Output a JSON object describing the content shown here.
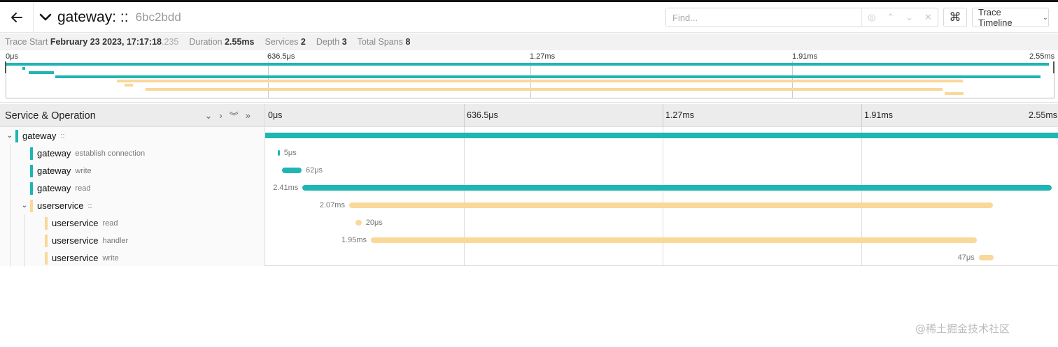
{
  "header": {
    "back_icon": "arrow-left-icon",
    "collapse_icon": "chevron-down-icon",
    "title": "gateway: ::",
    "trace_id": "6bc2bdd",
    "find_placeholder": "Find...",
    "keyboard_icon": "command-icon",
    "keyboard_glyph": "⌘",
    "view_select_value": "Trace Timeline"
  },
  "meta": {
    "trace_start_label": "Trace Start",
    "trace_start_value": "February 23 2023, 17:17:18",
    "trace_start_ms": ".235",
    "duration_label": "Duration",
    "duration_value": "2.55ms",
    "services_label": "Services",
    "services_value": "2",
    "depth_label": "Depth",
    "depth_value": "3",
    "total_spans_label": "Total Spans",
    "total_spans_value": "8"
  },
  "ticks": [
    "0μs",
    "636.5μs",
    "1.27ms",
    "1.91ms",
    "2.55ms"
  ],
  "table": {
    "service_operation_label": "Service & Operation"
  },
  "colors": {
    "gateway": "#1fb5b3",
    "userservice": "#f9d89a"
  },
  "spans": [
    {
      "service": "gateway",
      "operation": "::",
      "start": 0,
      "duration": 2550,
      "label": "",
      "depth": 0,
      "collapsible": true
    },
    {
      "service": "gateway",
      "operation": "establish connection",
      "start": 40,
      "duration": 5,
      "label": "5μs",
      "depth": 1,
      "collapsible": false
    },
    {
      "service": "gateway",
      "operation": "write",
      "start": 55,
      "duration": 62,
      "label": "62μs",
      "depth": 1,
      "collapsible": false
    },
    {
      "service": "gateway",
      "operation": "read",
      "start": 120,
      "duration": 2410,
      "label": "2.41ms",
      "depth": 1,
      "collapsible": false
    },
    {
      "service": "userservice",
      "operation": "::",
      "start": 270,
      "duration": 2070,
      "label": "2.07ms",
      "depth": 1,
      "collapsible": true
    },
    {
      "service": "userservice",
      "operation": "read",
      "start": 290,
      "duration": 20,
      "label": "20μs",
      "depth": 2,
      "collapsible": false
    },
    {
      "service": "userservice",
      "operation": "handler",
      "start": 340,
      "duration": 1950,
      "label": "1.95ms",
      "depth": 2,
      "collapsible": false
    },
    {
      "service": "userservice",
      "operation": "write",
      "start": 2295,
      "duration": 47,
      "label": "47μs",
      "depth": 2,
      "collapsible": false
    }
  ],
  "watermark": "@稀土掘金技术社区"
}
